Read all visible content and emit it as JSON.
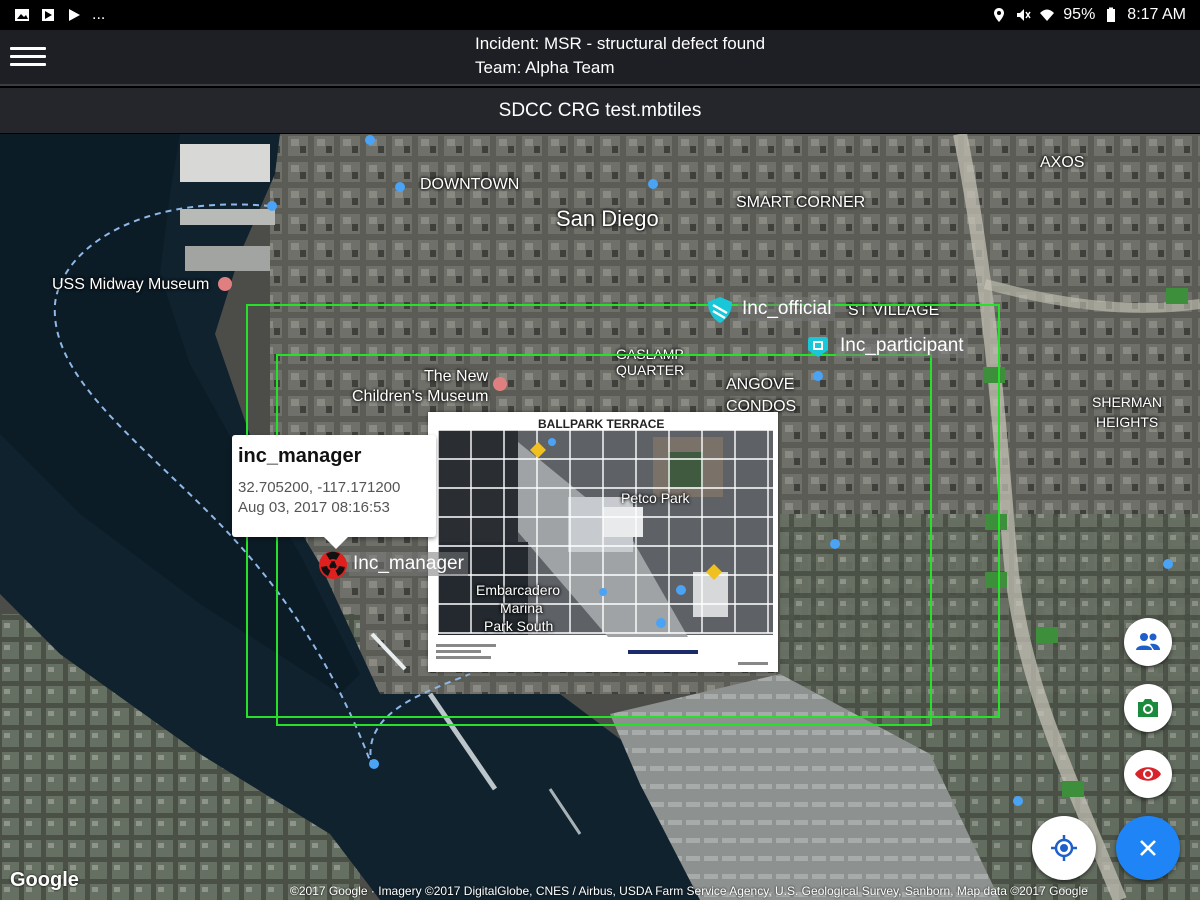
{
  "status_bar": {
    "left_icons": [
      "photo-icon",
      "flag-icon",
      "play-store-icon"
    ],
    "overflow": "...",
    "battery": "95%",
    "time": "8:17 AM",
    "right_icons": [
      "location-icon",
      "mute-icon",
      "wifi-icon",
      "battery-icon"
    ]
  },
  "app_bar": {
    "menu_icon": "hamburger-menu-icon",
    "incident": "Incident: MSR - structural defect found",
    "team": "Team: Alpha Team"
  },
  "title_bar": {
    "title": "SDCC CRG test.mbtiles"
  },
  "map": {
    "labels": {
      "downtown": "DOWNTOWN",
      "san_diego": "San Diego",
      "smart_corner": "SMART CORNER",
      "axos": "AXOS",
      "uss_midway": "USS Midway Museum",
      "east_village": "ST VILLAGE",
      "gaslamp": "GASLAMP",
      "quarter": "QUARTER",
      "new_childrens": "The New",
      "childrens_museum": "Children's Museum",
      "angove": "ANGOVE",
      "condos": "CONDOS",
      "sherman": "SHERMAN",
      "heights": "HEIGHTS",
      "ballpark": "BALLPARK",
      "petco": "Petco Park",
      "embarcadero": "Embarcadero",
      "marina": "Marina",
      "park_south": "Park South"
    },
    "users": {
      "official": "Inc_official",
      "participant": "Inc_participant",
      "manager": "Inc_manager"
    },
    "popup": {
      "title": "inc_manager",
      "coords": "32.705200, -117.171200",
      "timestamp": "Aug 03, 2017 08:16:53"
    },
    "overlay": {
      "title": "BALLPARK TERRACE"
    },
    "google": "Google",
    "attribution": "©2017 Google · Imagery ©2017 DigitalGlobe, CNES / Airbus, USDA Farm Service Agency, U.S. Geological Survey, Sanborn, Map data ©2017 Google"
  },
  "fabs": {
    "team": "people-icon",
    "camera": "camera-icon",
    "eye": "eye-icon",
    "locate": "my-location-icon",
    "close": "close-icon"
  },
  "colors": {
    "accent_blue": "#1f84f5",
    "outline_green": "#27e02a",
    "manager_red": "#e0201f",
    "official_cyan": "#19c7d8"
  }
}
